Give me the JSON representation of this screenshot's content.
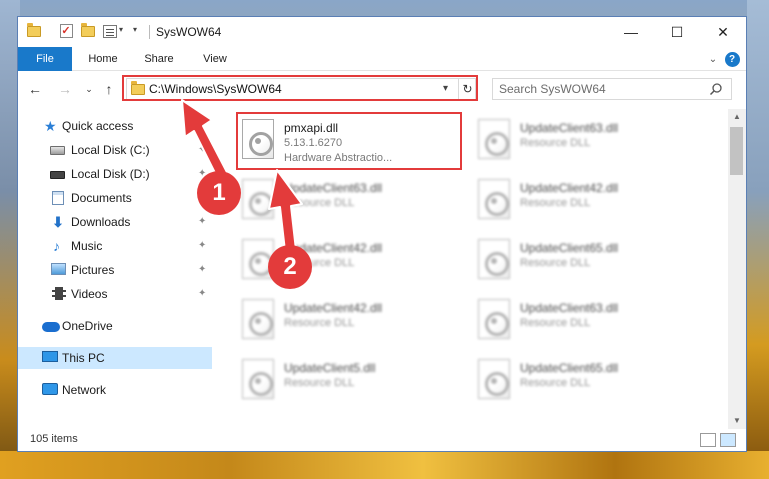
{
  "window": {
    "title": "SysWOW64",
    "minimize_glyph": "—",
    "maximize_glyph": "☐",
    "close_glyph": "✕"
  },
  "ribbon": {
    "tabs": [
      "File",
      "Home",
      "Share",
      "View"
    ],
    "expand_glyph": "⌄",
    "help_glyph": "?"
  },
  "nav": {
    "back_glyph": "←",
    "forward_glyph": "→",
    "recent_glyph": "⌄",
    "up_glyph": "↑",
    "address": "C:\\Windows\\SysWOW64",
    "refresh_glyph": "↻",
    "search_placeholder": "Search SysWOW64"
  },
  "sidebar": {
    "items": [
      {
        "label": "Quick access",
        "icon": "star-icon"
      },
      {
        "label": "Local Disk (C:)",
        "icon": "drive-icon"
      },
      {
        "label": "Local Disk (D:)",
        "icon": "drive-icon"
      },
      {
        "label": "Documents",
        "icon": "documents-icon"
      },
      {
        "label": "Downloads",
        "icon": "download-icon"
      },
      {
        "label": "Music",
        "icon": "music-icon"
      },
      {
        "label": "Pictures",
        "icon": "pictures-icon"
      },
      {
        "label": "Videos",
        "icon": "videos-icon"
      },
      {
        "label": "OneDrive",
        "icon": "cloud-icon"
      },
      {
        "label": "This PC",
        "icon": "computer-icon"
      },
      {
        "label": "Network",
        "icon": "network-icon"
      }
    ],
    "pin_glyph": "📌"
  },
  "files": [
    {
      "name": "pmxapi.dll",
      "version": "5.13.1.6270",
      "desc": "Hardware Abstractio..."
    },
    {
      "name": "UpdateClient63.dll",
      "desc": "Resource DLL"
    },
    {
      "name": "UpdateClient63.dll",
      "desc": "Resource DLL"
    },
    {
      "name": "UpdateClient42.dll",
      "desc": "Resource DLL"
    },
    {
      "name": "UpdateClient42.dll",
      "desc": "Resource DLL"
    },
    {
      "name": "UpdateClient65.dll",
      "desc": "Resource DLL"
    },
    {
      "name": "UpdateClient42.dll",
      "desc": "Resource DLL"
    },
    {
      "name": "UpdateClient63.dll",
      "desc": "Resource DLL"
    },
    {
      "name": "UpdateClient5.dll",
      "desc": "Resource DLL"
    },
    {
      "name": "UpdateClient65.dll",
      "desc": "Resource DLL"
    }
  ],
  "status": {
    "item_count": "105 items"
  },
  "annotations": {
    "badge1": "1",
    "badge2": "2",
    "color": "#e33b3b"
  }
}
